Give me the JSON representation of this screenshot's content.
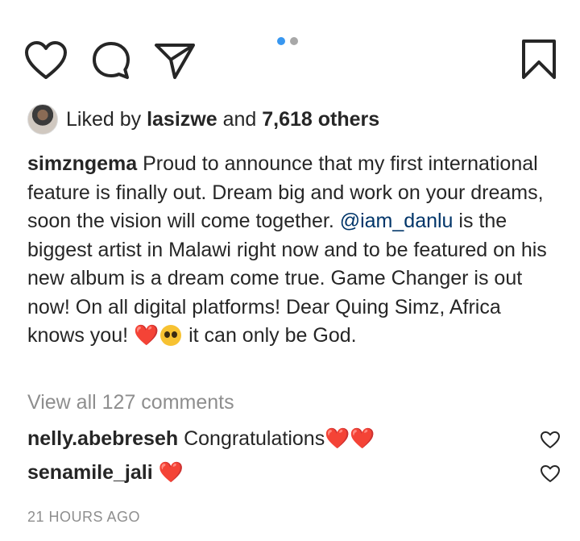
{
  "actions": {
    "like_icon": "heart-outline-icon",
    "comment_icon": "comment-bubble-icon",
    "share_icon": "paper-plane-icon",
    "save_icon": "bookmark-icon"
  },
  "carousel": {
    "total": 2,
    "active_index": 0,
    "active_color": "#3897f0"
  },
  "likes": {
    "prefix": "Liked by",
    "user": "lasizwe",
    "conjunction": "and",
    "others": "7,618 others"
  },
  "caption": {
    "username": "simzngema",
    "text_before_mention": "Proud to announce that my first international feature is finally out. Dream big and work on your dreams, soon the vision will come together.",
    "mention": "@iam_danlu",
    "text_after_mention": "is the biggest artist in Malawi right now and to be featured on his new album is a dream come true. Game Changer is out now! On all digital platforms! Dear Quing Simz, Africa knows you!",
    "emoji_heart": "❤️",
    "emoji_face_name": "pleading-face-emoji",
    "text_end": "it can only be God."
  },
  "view_all_comments": "View all 127 comments",
  "comments": [
    {
      "username": "nelly.abebreseh",
      "text": "Congratulations",
      "emoji": "❤️❤️"
    },
    {
      "username": "senamile_jali",
      "text": "",
      "emoji": "❤️"
    }
  ],
  "timestamp": "21 HOURS AGO",
  "colors": {
    "text": "#262626",
    "muted": "#8e8e8e",
    "mention": "#003569",
    "heart": "#e0182d"
  }
}
